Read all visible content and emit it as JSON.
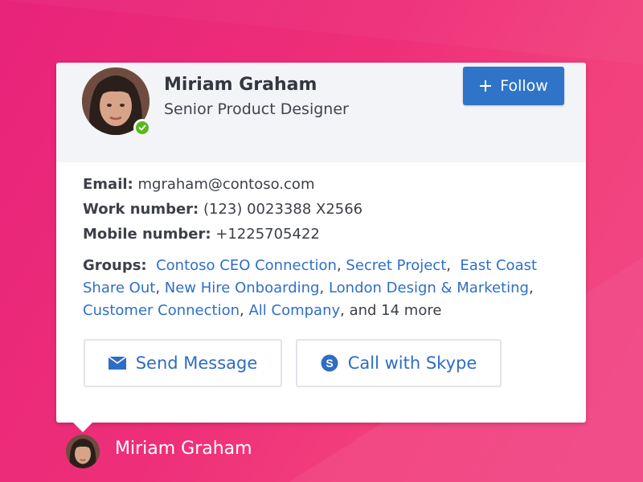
{
  "colors": {
    "background": "#ee2f78",
    "accent": "#2f74c8",
    "link": "#2f6fc7",
    "presence": "#58b81e",
    "header_bg": "#f3f4f8"
  },
  "profile": {
    "name": "Miriam Graham",
    "title": "Senior Product Designer",
    "presence": "available",
    "follow_label": "Follow"
  },
  "contact": {
    "email_label": "Email:",
    "email_value": "mgraham@contoso.com",
    "work_label": "Work number:",
    "work_value": "(123) 0023388 X2566",
    "mobile_label": "Mobile number:",
    "mobile_value": "+1225705422"
  },
  "groups": {
    "label": "Groups:",
    "items": [
      "Contoso CEO Connection",
      "Secret Project",
      "East Coast Share Out",
      "New Hire Onboarding",
      "London Design & Marketing",
      "Customer Connection",
      "All Company"
    ],
    "more_text": "and 14 more"
  },
  "actions": {
    "send_label": "Send Message",
    "skype_label": "Call with Skype"
  },
  "icons": [
    "plus-icon",
    "checkmark-icon",
    "mail-icon",
    "skype-icon"
  ],
  "footer": {
    "name": "Miriam Graham"
  }
}
